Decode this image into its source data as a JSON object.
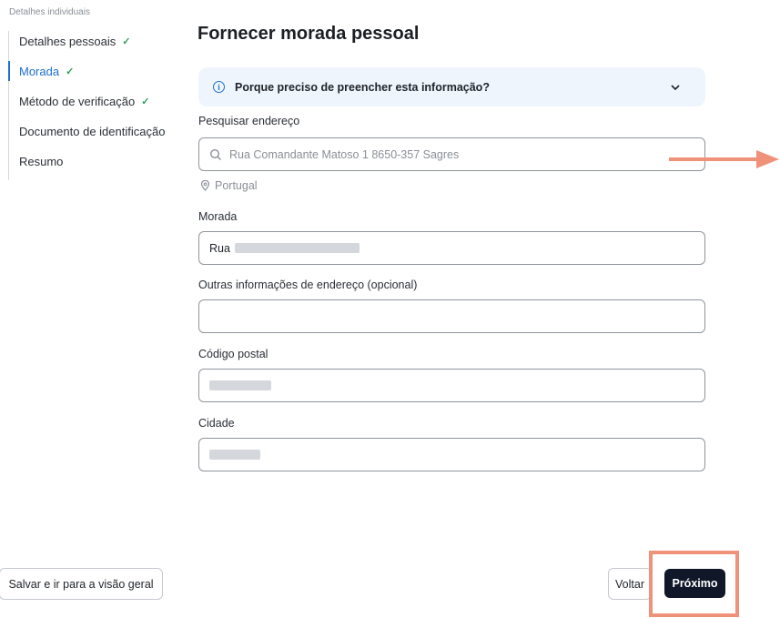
{
  "sidebar": {
    "header": "Detalhes individuais",
    "items": [
      {
        "label": "Detalhes pessoais",
        "check": "✓"
      },
      {
        "label": "Morada",
        "check": "✓"
      },
      {
        "label": "Método de verificação",
        "check": "✓"
      },
      {
        "label": "Documento de identificação",
        "check": ""
      },
      {
        "label": "Resumo",
        "check": ""
      }
    ]
  },
  "main": {
    "title": "Fornecer morada pessoal",
    "info_banner": "Porque preciso de preencher esta informação?",
    "search": {
      "label": "Pesquisar endereço",
      "placeholder": "Rua Comandante Matoso 1 8650-357 Sagres",
      "country": "Portugal"
    },
    "address": {
      "label": "Morada",
      "value": "Rua"
    },
    "address_extra": {
      "label": "Outras informações de endereço (opcional)",
      "value": ""
    },
    "postal_code": {
      "label": "Código postal"
    },
    "city": {
      "label": "Cidade"
    }
  },
  "footer": {
    "save_label": "Salvar e ir para a visão geral",
    "back_label": "Voltar",
    "next_label": "Próximo"
  },
  "colors": {
    "accent": "#1f6fd1",
    "primary_button": "#0f1729",
    "annotation": "#f0917a",
    "banner": "#eef5fd",
    "check": "#2e9e5b"
  }
}
